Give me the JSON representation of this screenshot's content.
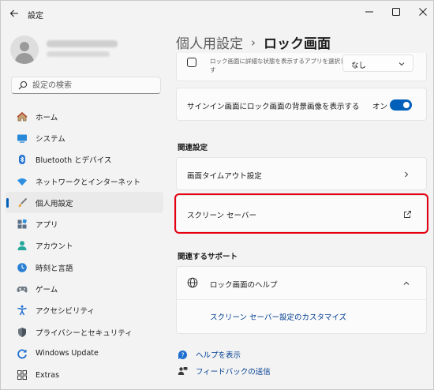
{
  "window": {
    "title": "設定"
  },
  "sidebar": {
    "search_placeholder": "設定の検索",
    "items": [
      {
        "label": "ホーム",
        "icon": "home-icon"
      },
      {
        "label": "システム",
        "icon": "system-icon"
      },
      {
        "label": "Bluetooth とデバイス",
        "icon": "bluetooth-icon"
      },
      {
        "label": "ネットワークとインターネット",
        "icon": "wifi-icon"
      },
      {
        "label": "個人用設定",
        "icon": "brush-icon",
        "active": true
      },
      {
        "label": "アプリ",
        "icon": "apps-icon"
      },
      {
        "label": "アカウント",
        "icon": "account-icon"
      },
      {
        "label": "時刻と言語",
        "icon": "time-language-icon"
      },
      {
        "label": "ゲーム",
        "icon": "gamepad-icon"
      },
      {
        "label": "アクセシビリティ",
        "icon": "accessibility-icon"
      },
      {
        "label": "プライバシーとセキュリティ",
        "icon": "shield-icon"
      },
      {
        "label": "Windows Update",
        "icon": "update-icon"
      },
      {
        "label": "Extras",
        "icon": "extras-icon"
      }
    ]
  },
  "main": {
    "breadcrumb_parent": "個人用設定",
    "breadcrumb_sep": "›",
    "breadcrumb_current": "ロック画面",
    "status_text": "ロック画面に詳細な状態を表示するアプリを選択します",
    "status_value": "なし",
    "signin_label": "サインイン画面にロック画面の背景画像を表示する",
    "signin_toggle_label": "オン",
    "signin_toggle_on": true,
    "related_heading": "関連設定",
    "timeout_label": "画面タイムアウト設定",
    "screensaver_label": "スクリーン セーバー",
    "support_heading": "関連するサポート",
    "help_title": "ロック画面のヘルプ",
    "help_link": "スクリーン セーバー設定のカスタマイズ",
    "get_help": "ヘルプを表示",
    "feedback": "フィードバックの送信"
  },
  "colors": {
    "accent": "#005fb8",
    "link": "#003e92",
    "highlight_border": "#e60012"
  }
}
